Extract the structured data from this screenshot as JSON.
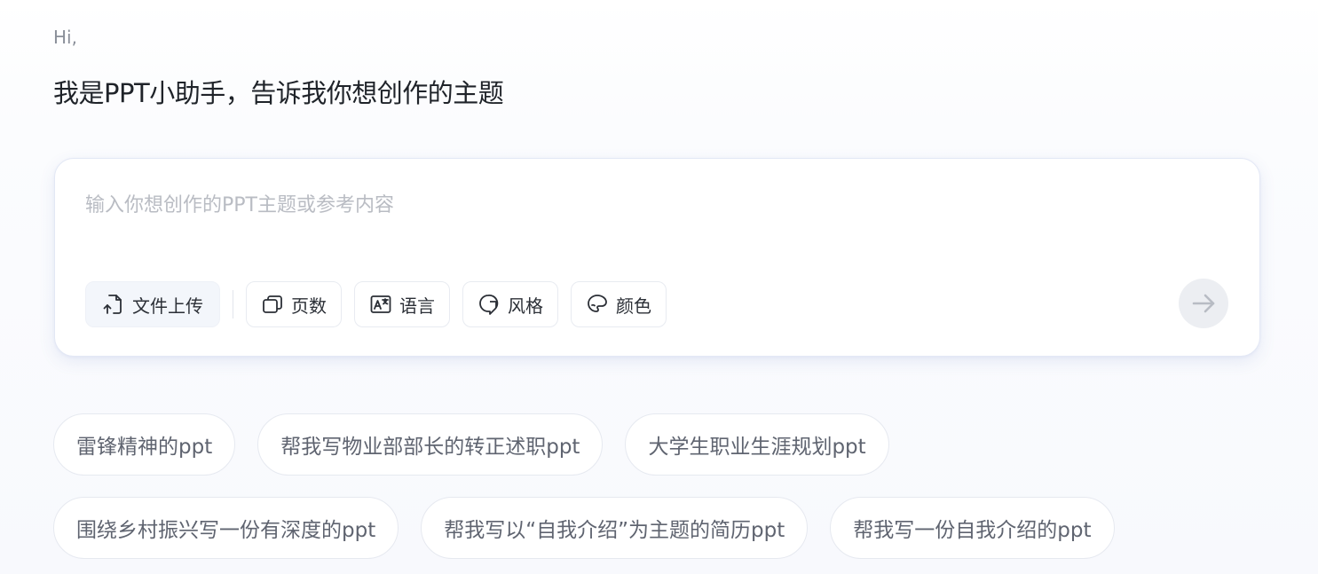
{
  "greeting": "Hi,",
  "title": "我是PPT小助手，告诉我你想创作的主题",
  "composer": {
    "placeholder": "输入你想创作的PPT主题或参考内容",
    "value": ""
  },
  "toolbar": {
    "upload_label": "文件上传",
    "pages_label": "页数",
    "language_label": "语言",
    "style_label": "风格",
    "color_label": "颜色"
  },
  "icons": {
    "upload": "file-upload-icon",
    "pages": "stacked-pages-icon",
    "language": "translate-icon",
    "style": "style-bubble-icon",
    "color": "palette-icon",
    "send": "arrow-right-icon"
  },
  "suggestions": {
    "row1": [
      "雷锋精神的ppt",
      "帮我写物业部部长的转正述职ppt",
      "大学生职业生涯规划ppt"
    ],
    "row2": [
      "围绕乡村振兴写一份有深度的ppt",
      "帮我写以“自我介绍”为主题的简历ppt",
      "帮我写一份自我介绍的ppt"
    ]
  },
  "colors": {
    "send_disabled_bg": "#eceef2",
    "send_arrow": "#b8bcc4",
    "chip_text": "#5f6470",
    "placeholder": "#b9bcc3"
  }
}
